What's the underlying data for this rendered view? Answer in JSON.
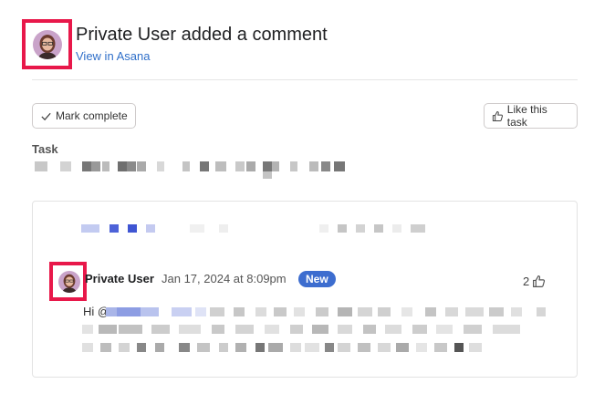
{
  "header": {
    "title": "Private User added a comment",
    "link_text": "View in Asana"
  },
  "actions": {
    "mark_complete": "Mark complete",
    "like_task": "Like this task"
  },
  "task": {
    "label": "Task"
  },
  "comment": {
    "author": "Private User",
    "timestamp": "Jan 17, 2024 at 8:09pm",
    "badge": "New",
    "like_count": "2",
    "greeting": "Hi @"
  },
  "colors": {
    "highlight_border": "#e8184a",
    "link": "#2f6fc9",
    "badge": "#3d6dcf"
  },
  "icons": [
    "check-icon",
    "thumbs-up-icon"
  ]
}
